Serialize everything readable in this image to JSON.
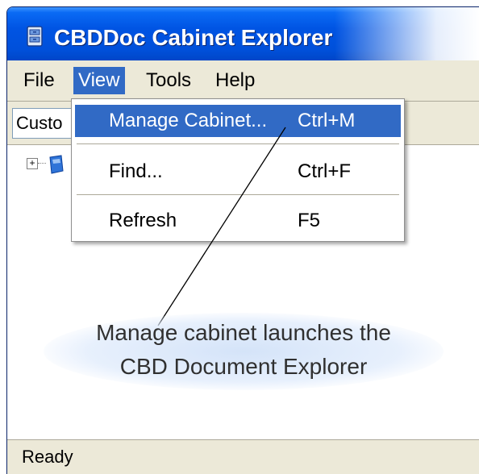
{
  "window": {
    "title": "CBDDoc Cabinet Explorer"
  },
  "menubar": {
    "items": [
      {
        "label": "File"
      },
      {
        "label": "View"
      },
      {
        "label": "Tools"
      },
      {
        "label": "Help"
      }
    ]
  },
  "toolbar": {
    "combo_value": "Custo"
  },
  "view_menu": {
    "items": [
      {
        "label": "Manage Cabinet...",
        "shortcut": "Ctrl+M"
      },
      {
        "label": "Find...",
        "shortcut": "Ctrl+F"
      },
      {
        "label": "Refresh",
        "shortcut": "F5"
      }
    ]
  },
  "annotation": {
    "line1": "Manage cabinet launches the",
    "line2": "CBD Document Explorer"
  },
  "statusbar": {
    "text": "Ready"
  },
  "colors": {
    "title_blue": "#0054e3",
    "highlight": "#316ac5",
    "window_face": "#ece9d8"
  },
  "icons": {
    "app": "cabinet-icon",
    "tree_node": "cabinet-node-icon"
  }
}
